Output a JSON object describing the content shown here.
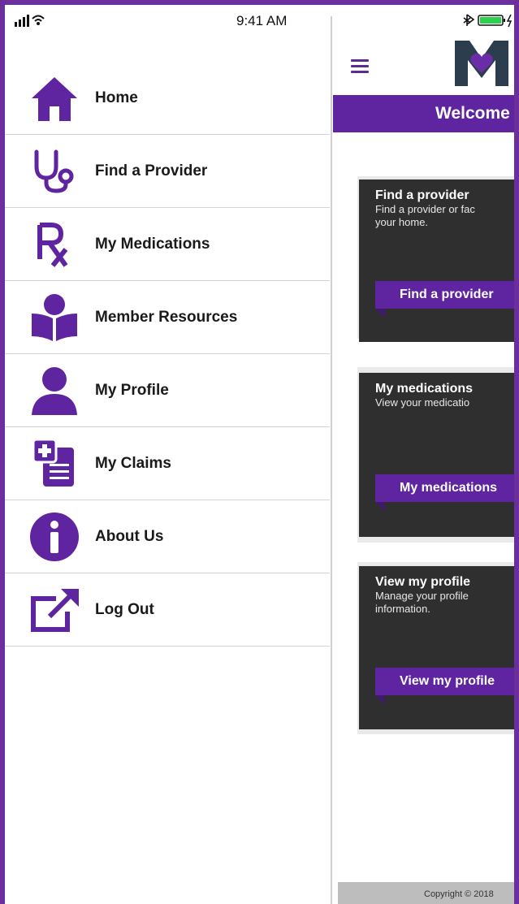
{
  "status_bar": {
    "time": "9:41 AM"
  },
  "menu": {
    "items": [
      {
        "label": "Home",
        "icon": "home-icon"
      },
      {
        "label": "Find a Provider",
        "icon": "stethoscope-icon"
      },
      {
        "label": "My Medications",
        "icon": "rx-icon"
      },
      {
        "label": "Member Resources",
        "icon": "reading-person-icon"
      },
      {
        "label": "My Profile",
        "icon": "person-icon"
      },
      {
        "label": "My Claims",
        "icon": "claims-document-icon"
      },
      {
        "label": "About Us",
        "icon": "info-icon"
      },
      {
        "label": "Log Out",
        "icon": "log-out-icon"
      }
    ]
  },
  "header": {
    "welcome": "Welcome"
  },
  "cards": [
    {
      "title": "Find a provider",
      "description": "Find a provider or fac\nyour home.",
      "button": "Find a provider"
    },
    {
      "title": "My medications",
      "description": "View your medicatio",
      "button": "My medications"
    },
    {
      "title": "View my profile",
      "description": "Manage your profile\ninformation.",
      "button": "View my profile"
    }
  ],
  "footer": {
    "copyright": "Copyright © 2018"
  },
  "colors": {
    "brand_purple": "#5f249f",
    "frame_purple": "#6a2f9d",
    "card_dark": "#2f2f30",
    "logo_dark": "#2c3e4e"
  }
}
